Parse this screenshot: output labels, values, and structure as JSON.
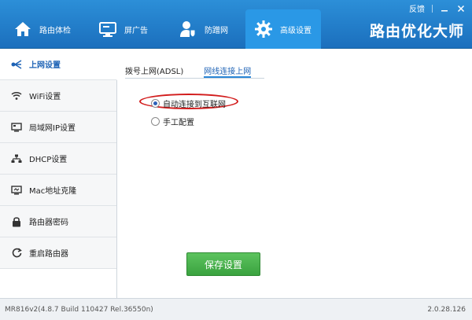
{
  "window": {
    "feedback_label": "反馈",
    "minimize_icon": "minimize-icon",
    "close_icon": "close-icon"
  },
  "nav": {
    "tabs": [
      {
        "label": "路由体检",
        "icon": "home-icon"
      },
      {
        "label": "屏广告",
        "icon": "monitor-icon"
      },
      {
        "label": "防蹭网",
        "icon": "user-shield-icon"
      },
      {
        "label": "高级设置",
        "icon": "gear-icon",
        "active": true
      }
    ],
    "brand": "路由优化大师"
  },
  "sidebar": {
    "items": [
      {
        "label": "上网设置",
        "icon": "network-icon",
        "active": true
      },
      {
        "label": "WiFi设置",
        "icon": "wifi-icon"
      },
      {
        "label": "局域网IP设置",
        "icon": "lan-icon"
      },
      {
        "label": "DHCP设置",
        "icon": "dhcp-icon"
      },
      {
        "label": "Mac地址克隆",
        "icon": "mac-clone-icon"
      },
      {
        "label": "路由器密码",
        "icon": "lock-icon"
      },
      {
        "label": "重启路由器",
        "icon": "restart-icon"
      }
    ]
  },
  "main": {
    "subtabs": [
      {
        "label": "拨号上网(ADSL)"
      },
      {
        "label": "网线连接上网",
        "active": true
      }
    ],
    "options": [
      {
        "label": "自动连接到互联网",
        "selected": true
      },
      {
        "label": "手工配置",
        "selected": false
      }
    ],
    "save_label": "保存设置"
  },
  "status": {
    "device": "MR816v2(4.8.7 Build 110427 Rel.36550n)",
    "version": "2.0.28.126"
  },
  "colors": {
    "topbar": "#1f7cc8",
    "active_tab": "#2a98e6",
    "save_button": "#45ad49",
    "highlight_ring": "#d21c1c"
  }
}
